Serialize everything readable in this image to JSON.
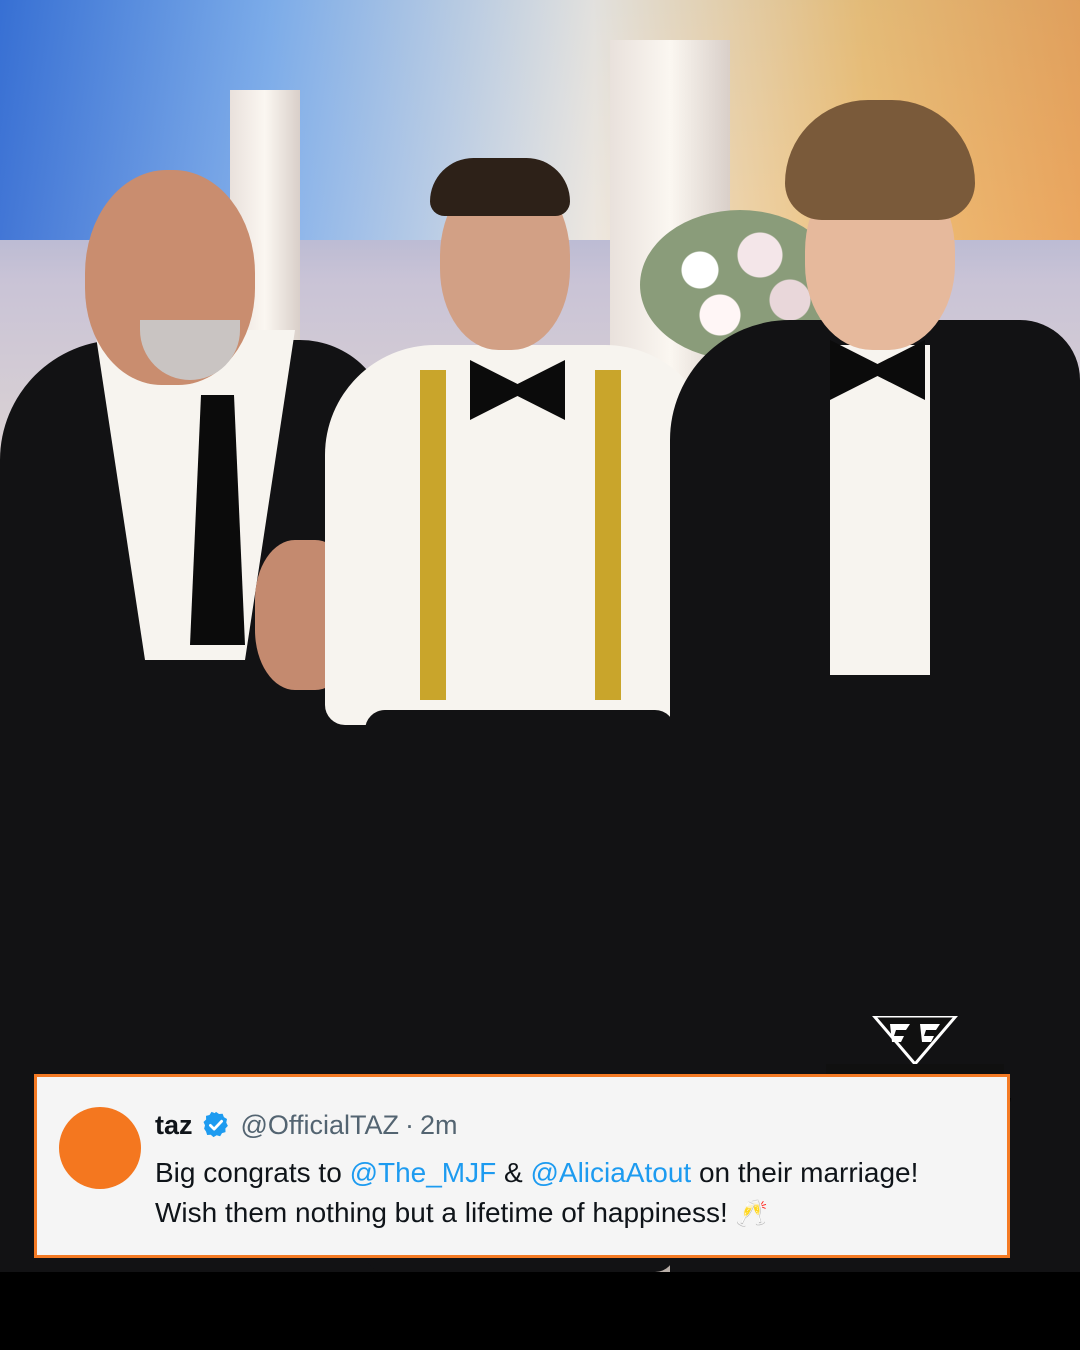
{
  "brand": {
    "logo_text": "FIGHTFUL",
    "accent_color": "#f47a24"
  },
  "tweet": {
    "display_name": "taz",
    "handle": "@OfficialTAZ",
    "separator": "·",
    "time": "2m",
    "verified_icon": "verified-badge-icon",
    "text_parts": [
      {
        "type": "text",
        "value": "Big congrats to "
      },
      {
        "type": "mention",
        "value": "@The_MJF"
      },
      {
        "type": "text",
        "value": " & "
      },
      {
        "type": "mention",
        "value": "@AliciaAtout"
      },
      {
        "type": "text",
        "value": " on their marriage!"
      }
    ],
    "line2": "Wish them nothing but a lifetime of happiness!",
    "emoji": "🥂"
  }
}
